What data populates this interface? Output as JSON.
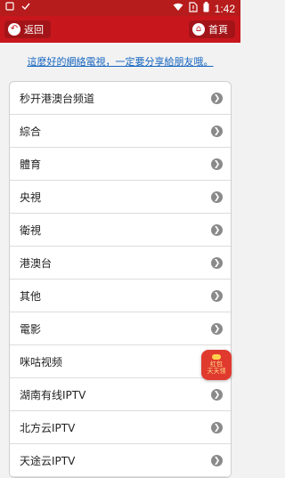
{
  "status_bar": {
    "time": "1:42",
    "left_icons": [
      "app-icon",
      "check-icon"
    ],
    "right_icons": [
      "wifi-icon",
      "no-sim-icon",
      "battery-icon"
    ]
  },
  "nav": {
    "back_label": "返回",
    "home_label": "首頁"
  },
  "banner": {
    "text": "這麼好的網絡電視，一定要分享給朋友哦。"
  },
  "list": {
    "items": [
      {
        "label": "秒开港澳台频道"
      },
      {
        "label": "綜合"
      },
      {
        "label": "體育"
      },
      {
        "label": "央視"
      },
      {
        "label": "衛視"
      },
      {
        "label": "港澳台"
      },
      {
        "label": "其他"
      },
      {
        "label": "電影"
      },
      {
        "label": "咪咕视频"
      },
      {
        "label": "湖南有线IPTV"
      },
      {
        "label": "北方云IPTV"
      },
      {
        "label": "天途云IPTV"
      }
    ]
  },
  "red_packet": {
    "line1": "红包",
    "line2": "天天领"
  },
  "colors": {
    "header": "#c8161d",
    "status_bar": "#b71c1c",
    "link": "#1565c0",
    "arrow": "#8a8a8a"
  }
}
